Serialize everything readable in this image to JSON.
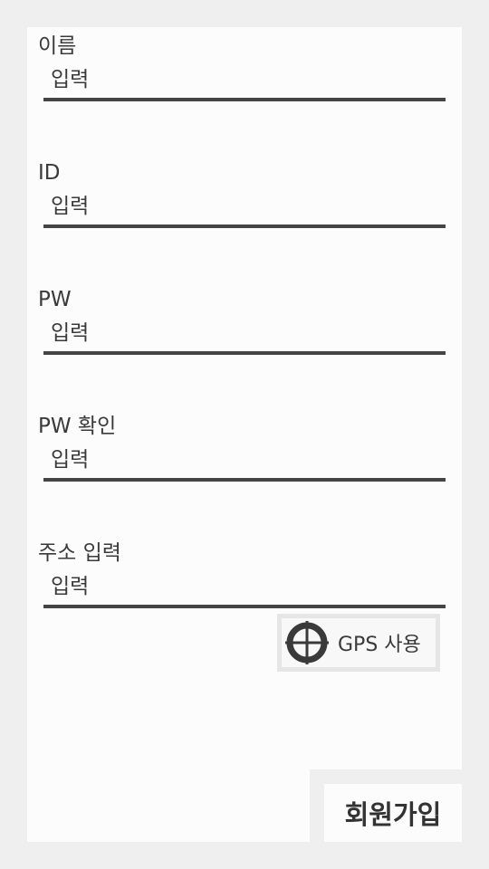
{
  "form": {
    "fields": [
      {
        "label": "이름",
        "placeholder": "입력"
      },
      {
        "label": "ID",
        "placeholder": "입력"
      },
      {
        "label": "PW",
        "placeholder": "입력"
      },
      {
        "label": "PW 확인",
        "placeholder": "입력"
      },
      {
        "label": "주소 입력",
        "placeholder": "입력"
      }
    ]
  },
  "gps": {
    "label": "GPS 사용",
    "icon": "crosshair-icon"
  },
  "signup": {
    "label": "회원가입"
  }
}
